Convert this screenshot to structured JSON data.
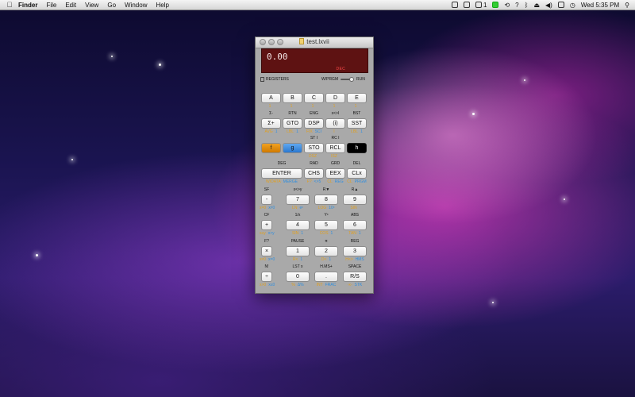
{
  "menubar": {
    "app": "Finder",
    "items": [
      "File",
      "Edit",
      "View",
      "Go",
      "Window",
      "Help"
    ],
    "status": {
      "battery_count": "1",
      "clock": "Wed 5:35 PM"
    }
  },
  "window": {
    "title": "test.lxvii",
    "display_value": "0.00",
    "display_flag": "DEC",
    "registers_label": "REGISTERS",
    "mode_label": "W/PRGM",
    "run_label": "RUN"
  },
  "keys": {
    "row1": [
      {
        "label": "A",
        "bottom_o": "1",
        "bottom_b": ""
      },
      {
        "label": "B",
        "bottom_o": "1",
        "bottom_b": ""
      },
      {
        "label": "C",
        "bottom_o": "1",
        "bottom_b": ""
      },
      {
        "label": "D",
        "bottom_o": "1",
        "bottom_b": ""
      },
      {
        "label": "E",
        "bottom_o": "1",
        "bottom_b": ""
      }
    ],
    "row2": [
      {
        "top": "Σ-",
        "label": "Σ+",
        "bottom_o": "AVG",
        "bottom_b": "1"
      },
      {
        "top": "RTN",
        "label": "GTO",
        "bottom_o": "LBL",
        "bottom_b": "1"
      },
      {
        "top": "ENG",
        "label": "DSP",
        "bottom_o": "FIX",
        "bottom_b": "SCI"
      },
      {
        "top": "x<>I",
        "label": "(i)",
        "bottom_o": "I",
        "bottom_b": ""
      },
      {
        "top": "BST",
        "label": "SST",
        "bottom_o": "LBL",
        "bottom_b": "1"
      }
    ],
    "row3": [
      {
        "top": "",
        "label": "f",
        "bottom_o": "",
        "bottom_b": ""
      },
      {
        "top": "",
        "label": "g",
        "bottom_o": "",
        "bottom_b": ""
      },
      {
        "top": "ST I",
        "label": "STO",
        "bottom_o": "DSZ",
        "bottom_b": ""
      },
      {
        "top": "RC I",
        "label": "RCL",
        "bottom_o": "ISZ",
        "bottom_b": ""
      },
      {
        "top": "",
        "label": "h",
        "bottom_o": "",
        "bottom_b": ""
      }
    ],
    "row4": [
      {
        "top": "DEG",
        "label": "ENTER",
        "bottom_o": "W/DATA",
        "bottom_b": "MERGE"
      },
      {
        "top": "RAD",
        "label": "CHS",
        "bottom_o": "F?",
        "bottom_b": "<>5"
      },
      {
        "top": "GRD",
        "label": "EEX",
        "bottom_o": "CL",
        "bottom_b": "REG"
      },
      {
        "top": "DEL",
        "label": "CLx",
        "bottom_o": "CL",
        "bottom_b": "PRGM"
      }
    ],
    "row5": [
      {
        "top": "SF",
        "label": "-",
        "bottom_o": "x=0",
        "bottom_b": "x≠0"
      },
      {
        "top": "x<>y",
        "label": "7",
        "bottom_o": "LN",
        "bottom_b": "eˣ"
      },
      {
        "top": "R▼",
        "label": "8",
        "bottom_o": "LOG",
        "bottom_b": "10ˣ"
      },
      {
        "top": "R▲",
        "label": "9",
        "bottom_o": "SIN",
        "bottom_b": ""
      }
    ],
    "row6": [
      {
        "top": "CF",
        "label": "+",
        "bottom_o": "x≤y",
        "bottom_b": "x>y"
      },
      {
        "top": "1/x",
        "label": "4",
        "bottom_o": "SIN",
        "bottom_b": "1"
      },
      {
        "top": "Yˣ",
        "label": "5",
        "bottom_o": "COS",
        "bottom_b": "1"
      },
      {
        "top": "ABS",
        "label": "6",
        "bottom_o": "TAN",
        "bottom_b": "1"
      }
    ],
    "row7": [
      {
        "top": "F?",
        "label": "×",
        "bottom_o": "x≠0",
        "bottom_b": "x=0"
      },
      {
        "top": "PAUSE",
        "label": "1",
        "bottom_o": "R<",
        "bottom_b": "1"
      },
      {
        "top": "π",
        "label": "2",
        "bottom_o": "D<",
        "bottom_b": "1"
      },
      {
        "top": "REG",
        "label": "3",
        "bottom_o": "H<>",
        "bottom_b": "HMS"
      }
    ],
    "row8": [
      {
        "top": "N!",
        "label": "÷",
        "bottom_o": "x>0",
        "bottom_b": "x≤0"
      },
      {
        "top": "LST x",
        "label": "0",
        "bottom_o": "%",
        "bottom_b": "Δ%"
      },
      {
        "top": "H.MS+",
        "label": ".",
        "bottom_o": "INT",
        "bottom_b": "FRAC"
      },
      {
        "top": "SPACE",
        "label": "R/S",
        "bottom_o": "-x-",
        "bottom_b": "STK"
      }
    ]
  }
}
